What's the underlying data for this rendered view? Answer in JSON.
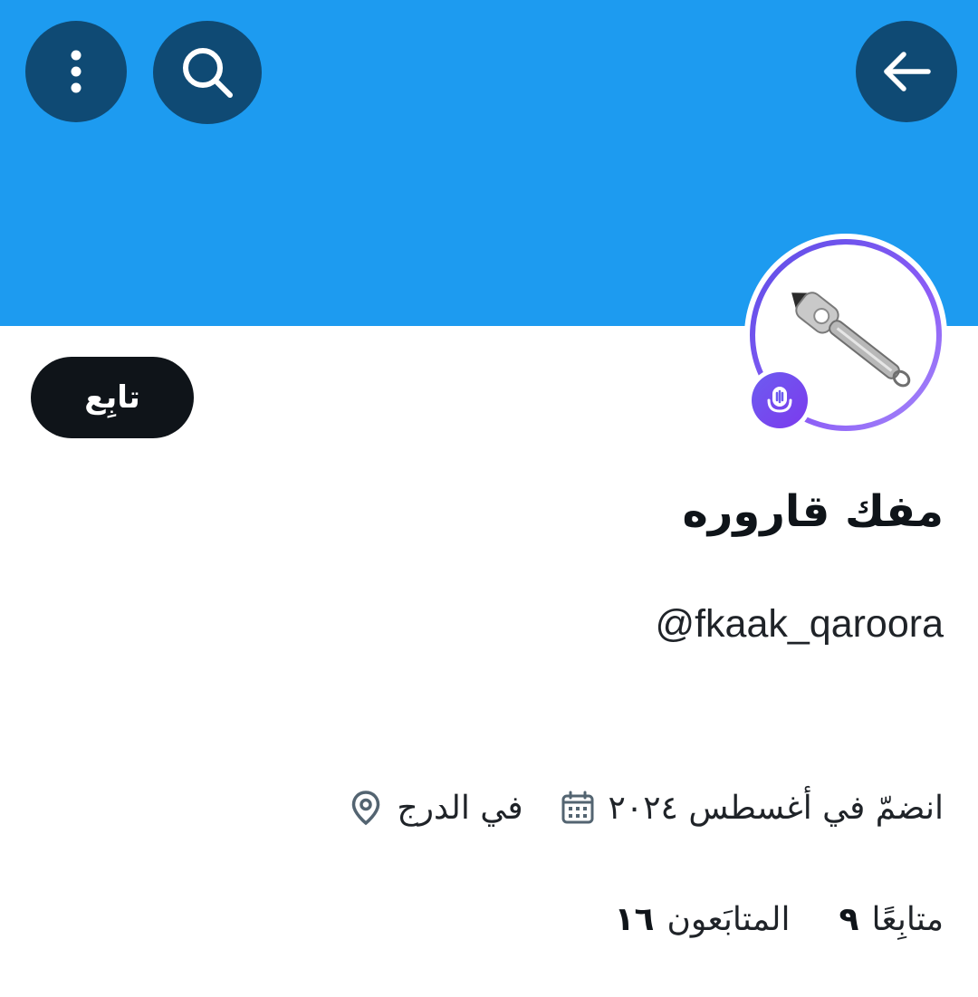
{
  "header": {
    "back_icon": "arrow-left-icon",
    "search_icon": "search-icon",
    "more_icon": "more-vertical-icon",
    "banner_color": "#1d9bf0",
    "button_color": "#0f4a74"
  },
  "profile": {
    "avatar_icon": "bottle-opener-image",
    "space_badge_icon": "spaces-microphone-icon",
    "display_name": "مفك قاروره",
    "handle": "@fkaak_qaroora",
    "follow_label": "تابِع",
    "location": "في الدرج",
    "joined": "انضمّ في أغسطس ٢٠٢٤",
    "location_icon": "location-pin-icon",
    "joined_icon": "calendar-icon"
  },
  "stats": {
    "followers_count": "١٦",
    "followers_label": "المتابَعون",
    "following_count": "٩",
    "following_label": "متابِعًا"
  }
}
